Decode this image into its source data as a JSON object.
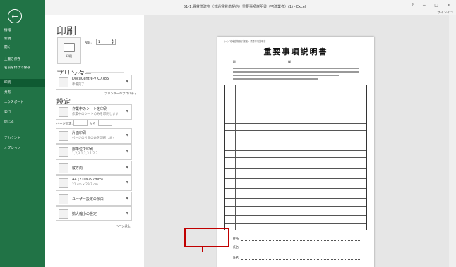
{
  "window": {
    "title": "51-1.賃貸借建物（普通賃貸借契約）重要事項説明書（宅建業者）(1) - Excel",
    "controls": [
      "?",
      "−",
      "□",
      "×"
    ],
    "signin": "サインイン"
  },
  "backstage": {
    "back_label": "←",
    "items": [
      {
        "label": "情報"
      },
      {
        "label": "新規"
      },
      {
        "label": "開く"
      },
      {
        "label": "上書き保存"
      },
      {
        "label": "名前を付けて保存"
      },
      {
        "label": "印刷"
      },
      {
        "label": "共有"
      },
      {
        "label": "エクスポート"
      },
      {
        "label": "発行"
      },
      {
        "label": "閉じる"
      },
      {
        "label": "アカウント"
      },
      {
        "label": "オプション"
      }
    ]
  },
  "print": {
    "title": "印刷",
    "button_label": "印刷",
    "copies_label": "部数:",
    "copies_value": "1",
    "printer_section": "プリンター",
    "printer_name": "DocuCentre-V C7785",
    "printer_status": "準備完了",
    "printer_props": "プリンターのプロパティ",
    "settings_section": "設定",
    "opt_sheet_t1": "作業中のシートを印刷",
    "opt_sheet_t2": "作業中のシートのみを印刷します",
    "pages_label": "ページ指定:",
    "pages_to": "から",
    "opt_side_t1": "片面印刷",
    "opt_side_t2": "ページの片面のみを印刷します",
    "opt_collate_t1": "部単位で印刷",
    "opt_collate_t2": "1,2,3    1,2,3    1,2,3",
    "opt_orient_t1": "縦方向",
    "opt_paper_t1": "A4 (210x297mm)",
    "opt_paper_t2": "21 cm x 29.7 cm",
    "opt_margin_t1": "ユーザー設定の余白",
    "opt_scale_t1": "拡大縮小の設定",
    "page_setup_link": "ページ設定"
  },
  "document": {
    "header_small": "（一）宅地建物取引業者・重要事項説明書",
    "title": "重要事項説明書",
    "addressee": "殿",
    "to_label": "様",
    "sig_labels": [
      "住所",
      "氏名",
      "氏名"
    ]
  },
  "colors": {
    "backstage_green": "#217346",
    "highlight": "#c00000"
  }
}
